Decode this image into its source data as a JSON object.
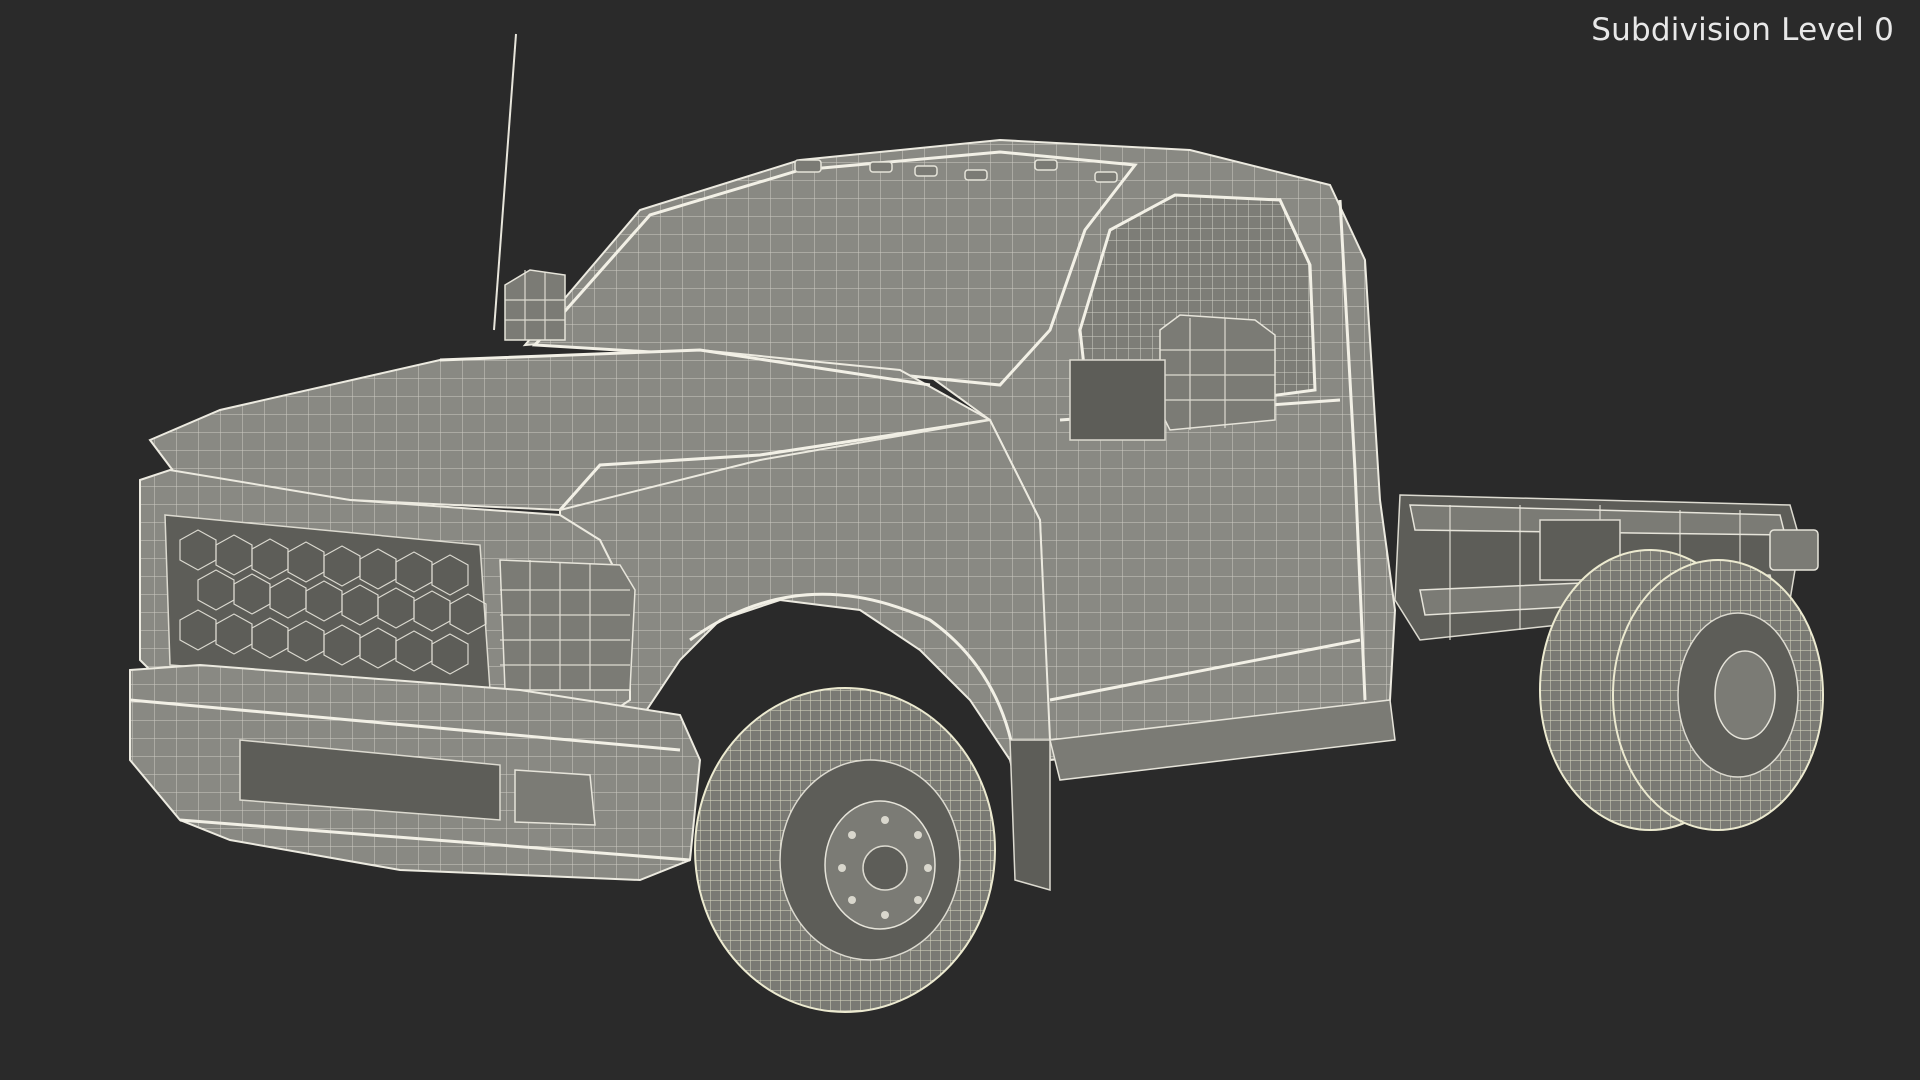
{
  "viewport": {
    "overlay_label": "Subdivision Level 0",
    "background_color": "#2a2a2a",
    "model_fill_color": "#8a8a84",
    "wire_color": "#eceae0"
  }
}
